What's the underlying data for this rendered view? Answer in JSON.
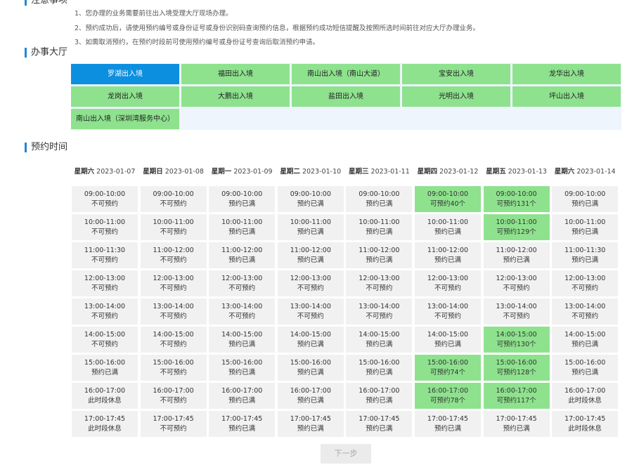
{
  "notices": {
    "section_title": "注意事项",
    "items": [
      "1、您办理的业务需要前往出入境受理大厅现场办理。",
      "2、预约成功后，请使用预约编号或身份证号或身份识别码查询预约信息，根据预约成功短信提醒及按照所选时间前往对应大厅办理业务。",
      "3、如需取消预约，在预约时段前可使用预约编号或身份证号查询后取消预约申请。"
    ]
  },
  "halls": {
    "section_title": "办事大厅",
    "items": [
      {
        "label": "罗湖出入境",
        "selected": true
      },
      {
        "label": "福田出入境",
        "selected": false
      },
      {
        "label": "南山出入境（南山大道）",
        "selected": false
      },
      {
        "label": "宝安出入境",
        "selected": false
      },
      {
        "label": "龙华出入境",
        "selected": false
      },
      {
        "label": "龙岗出入境",
        "selected": false
      },
      {
        "label": "大鹏出入境",
        "selected": false
      },
      {
        "label": "盐田出入境",
        "selected": false
      },
      {
        "label": "光明出入境",
        "selected": false
      },
      {
        "label": "坪山出入境",
        "selected": false
      },
      {
        "label": "南山出入境（深圳湾服务中心）",
        "selected": false
      }
    ]
  },
  "schedule": {
    "section_title": "预约时间",
    "days": [
      {
        "weekday": "星期六",
        "date": "2023-01-07",
        "slots": [
          {
            "time": "09:00-10:00",
            "status": "不可预约",
            "available": false
          },
          {
            "time": "10:00-11:00",
            "status": "不可预约",
            "available": false
          },
          {
            "time": "11:00-11:30",
            "status": "不可预约",
            "available": false
          },
          {
            "time": "12:00-13:00",
            "status": "不可预约",
            "available": false
          },
          {
            "time": "13:00-14:00",
            "status": "不可预约",
            "available": false
          },
          {
            "time": "14:00-15:00",
            "status": "不可预约",
            "available": false
          },
          {
            "time": "15:00-16:00",
            "status": "预约已满",
            "available": false
          },
          {
            "time": "16:00-17:00",
            "status": "此时段休息",
            "available": false
          },
          {
            "time": "17:00-17:45",
            "status": "此时段休息",
            "available": false
          }
        ]
      },
      {
        "weekday": "星期日",
        "date": "2023-01-08",
        "slots": [
          {
            "time": "09:00-10:00",
            "status": "不可预约",
            "available": false
          },
          {
            "time": "10:00-11:00",
            "status": "不可预约",
            "available": false
          },
          {
            "time": "11:00-12:00",
            "status": "不可预约",
            "available": false
          },
          {
            "time": "12:00-13:00",
            "status": "不可预约",
            "available": false
          },
          {
            "time": "13:00-14:00",
            "status": "不可预约",
            "available": false
          },
          {
            "time": "14:00-15:00",
            "status": "不可预约",
            "available": false
          },
          {
            "time": "15:00-16:00",
            "status": "不可预约",
            "available": false
          },
          {
            "time": "16:00-17:00",
            "status": "不可预约",
            "available": false
          },
          {
            "time": "17:00-17:45",
            "status": "不可预约",
            "available": false
          }
        ]
      },
      {
        "weekday": "星期一",
        "date": "2023-01-09",
        "slots": [
          {
            "time": "09:00-10:00",
            "status": "预约已满",
            "available": false
          },
          {
            "time": "10:00-11:00",
            "status": "预约已满",
            "available": false
          },
          {
            "time": "11:00-12:00",
            "status": "预约已满",
            "available": false
          },
          {
            "time": "12:00-13:00",
            "status": "不可预约",
            "available": false
          },
          {
            "time": "13:00-14:00",
            "status": "不可预约",
            "available": false
          },
          {
            "time": "14:00-15:00",
            "status": "预约已满",
            "available": false
          },
          {
            "time": "15:00-16:00",
            "status": "预约已满",
            "available": false
          },
          {
            "time": "16:00-17:00",
            "status": "预约已满",
            "available": false
          },
          {
            "time": "17:00-17:45",
            "status": "预约已满",
            "available": false
          }
        ]
      },
      {
        "weekday": "星期二",
        "date": "2023-01-10",
        "slots": [
          {
            "time": "09:00-10:00",
            "status": "预约已满",
            "available": false
          },
          {
            "time": "10:00-11:00",
            "status": "预约已满",
            "available": false
          },
          {
            "time": "11:00-12:00",
            "status": "预约已满",
            "available": false
          },
          {
            "time": "12:00-13:00",
            "status": "不可预约",
            "available": false
          },
          {
            "time": "13:00-14:00",
            "status": "不可预约",
            "available": false
          },
          {
            "time": "14:00-15:00",
            "status": "预约已满",
            "available": false
          },
          {
            "time": "15:00-16:00",
            "status": "预约已满",
            "available": false
          },
          {
            "time": "16:00-17:00",
            "status": "预约已满",
            "available": false
          },
          {
            "time": "17:00-17:45",
            "status": "预约已满",
            "available": false
          }
        ]
      },
      {
        "weekday": "星期三",
        "date": "2023-01-11",
        "slots": [
          {
            "time": "09:00-10:00",
            "status": "预约已满",
            "available": false
          },
          {
            "time": "10:00-11:00",
            "status": "预约已满",
            "available": false
          },
          {
            "time": "11:00-12:00",
            "status": "预约已满",
            "available": false
          },
          {
            "time": "12:00-13:00",
            "status": "不可预约",
            "available": false
          },
          {
            "time": "13:00-14:00",
            "status": "不可预约",
            "available": false
          },
          {
            "time": "14:00-15:00",
            "status": "预约已满",
            "available": false
          },
          {
            "time": "15:00-16:00",
            "status": "预约已满",
            "available": false
          },
          {
            "time": "16:00-17:00",
            "status": "预约已满",
            "available": false
          },
          {
            "time": "17:00-17:45",
            "status": "预约已满",
            "available": false
          }
        ]
      },
      {
        "weekday": "星期四",
        "date": "2023-01-12",
        "slots": [
          {
            "time": "09:00-10:00",
            "status": "可预约40个",
            "available": true
          },
          {
            "time": "10:00-11:00",
            "status": "预约已满",
            "available": false
          },
          {
            "time": "11:00-12:00",
            "status": "预约已满",
            "available": false
          },
          {
            "time": "12:00-13:00",
            "status": "不可预约",
            "available": false
          },
          {
            "time": "13:00-14:00",
            "status": "不可预约",
            "available": false
          },
          {
            "time": "14:00-15:00",
            "status": "预约已满",
            "available": false
          },
          {
            "time": "15:00-16:00",
            "status": "可预约74个",
            "available": true
          },
          {
            "time": "16:00-17:00",
            "status": "可预约78个",
            "available": true
          },
          {
            "time": "17:00-17:45",
            "status": "预约已满",
            "available": false
          }
        ]
      },
      {
        "weekday": "星期五",
        "date": "2023-01-13",
        "slots": [
          {
            "time": "09:00-10:00",
            "status": "可预约131个",
            "available": true
          },
          {
            "time": "10:00-11:00",
            "status": "可预约129个",
            "available": true
          },
          {
            "time": "11:00-12:00",
            "status": "预约已满",
            "available": false
          },
          {
            "time": "12:00-13:00",
            "status": "不可预约",
            "available": false
          },
          {
            "time": "13:00-14:00",
            "status": "不可预约",
            "available": false
          },
          {
            "time": "14:00-15:00",
            "status": "可预约130个",
            "available": true
          },
          {
            "time": "15:00-16:00",
            "status": "可预约128个",
            "available": true
          },
          {
            "time": "16:00-17:00",
            "status": "可预约117个",
            "available": true
          },
          {
            "time": "17:00-17:45",
            "status": "预约已满",
            "available": false
          }
        ]
      },
      {
        "weekday": "星期六",
        "date": "2023-01-14",
        "slots": [
          {
            "time": "09:00-10:00",
            "status": "预约已满",
            "available": false
          },
          {
            "time": "10:00-11:00",
            "status": "预约已满",
            "available": false
          },
          {
            "time": "11:00-11:30",
            "status": "预约已满",
            "available": false
          },
          {
            "time": "12:00-13:00",
            "status": "不可预约",
            "available": false
          },
          {
            "time": "13:00-14:00",
            "status": "不可预约",
            "available": false
          },
          {
            "time": "14:00-15:00",
            "status": "预约已满",
            "available": false
          },
          {
            "time": "15:00-16:00",
            "status": "预约已满",
            "available": false
          },
          {
            "time": "16:00-17:00",
            "status": "此时段休息",
            "available": false
          },
          {
            "time": "17:00-17:45",
            "status": "此时段休息",
            "available": false
          }
        ]
      }
    ]
  },
  "next_button": {
    "label": "下一步"
  },
  "colors": {
    "accent": "#1e88d8",
    "selected_hall": "#0d8fe0",
    "available_green": "#8ee28e",
    "unavailable_gray": "#f1f1f1"
  }
}
